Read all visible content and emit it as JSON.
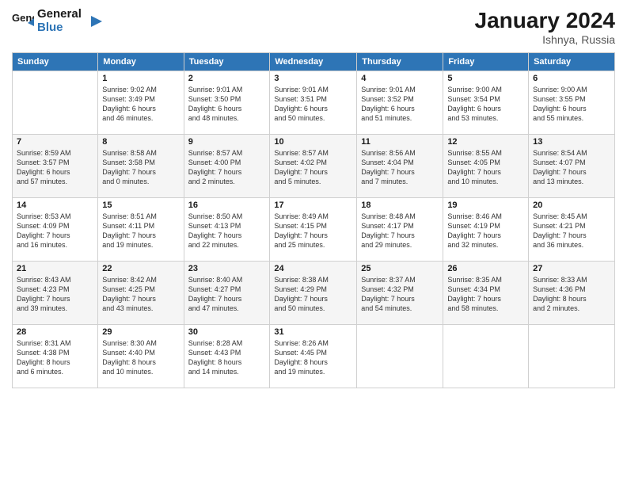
{
  "header": {
    "logo_line1": "General",
    "logo_line2": "Blue",
    "month_year": "January 2024",
    "location": "Ishnya, Russia"
  },
  "days_of_week": [
    "Sunday",
    "Monday",
    "Tuesday",
    "Wednesday",
    "Thursday",
    "Friday",
    "Saturday"
  ],
  "weeks": [
    [
      {
        "num": "",
        "info": ""
      },
      {
        "num": "1",
        "info": "Sunrise: 9:02 AM\nSunset: 3:49 PM\nDaylight: 6 hours\nand 46 minutes."
      },
      {
        "num": "2",
        "info": "Sunrise: 9:01 AM\nSunset: 3:50 PM\nDaylight: 6 hours\nand 48 minutes."
      },
      {
        "num": "3",
        "info": "Sunrise: 9:01 AM\nSunset: 3:51 PM\nDaylight: 6 hours\nand 50 minutes."
      },
      {
        "num": "4",
        "info": "Sunrise: 9:01 AM\nSunset: 3:52 PM\nDaylight: 6 hours\nand 51 minutes."
      },
      {
        "num": "5",
        "info": "Sunrise: 9:00 AM\nSunset: 3:54 PM\nDaylight: 6 hours\nand 53 minutes."
      },
      {
        "num": "6",
        "info": "Sunrise: 9:00 AM\nSunset: 3:55 PM\nDaylight: 6 hours\nand 55 minutes."
      }
    ],
    [
      {
        "num": "7",
        "info": "Sunrise: 8:59 AM\nSunset: 3:57 PM\nDaylight: 6 hours\nand 57 minutes."
      },
      {
        "num": "8",
        "info": "Sunrise: 8:58 AM\nSunset: 3:58 PM\nDaylight: 7 hours\nand 0 minutes."
      },
      {
        "num": "9",
        "info": "Sunrise: 8:57 AM\nSunset: 4:00 PM\nDaylight: 7 hours\nand 2 minutes."
      },
      {
        "num": "10",
        "info": "Sunrise: 8:57 AM\nSunset: 4:02 PM\nDaylight: 7 hours\nand 5 minutes."
      },
      {
        "num": "11",
        "info": "Sunrise: 8:56 AM\nSunset: 4:04 PM\nDaylight: 7 hours\nand 7 minutes."
      },
      {
        "num": "12",
        "info": "Sunrise: 8:55 AM\nSunset: 4:05 PM\nDaylight: 7 hours\nand 10 minutes."
      },
      {
        "num": "13",
        "info": "Sunrise: 8:54 AM\nSunset: 4:07 PM\nDaylight: 7 hours\nand 13 minutes."
      }
    ],
    [
      {
        "num": "14",
        "info": "Sunrise: 8:53 AM\nSunset: 4:09 PM\nDaylight: 7 hours\nand 16 minutes."
      },
      {
        "num": "15",
        "info": "Sunrise: 8:51 AM\nSunset: 4:11 PM\nDaylight: 7 hours\nand 19 minutes."
      },
      {
        "num": "16",
        "info": "Sunrise: 8:50 AM\nSunset: 4:13 PM\nDaylight: 7 hours\nand 22 minutes."
      },
      {
        "num": "17",
        "info": "Sunrise: 8:49 AM\nSunset: 4:15 PM\nDaylight: 7 hours\nand 25 minutes."
      },
      {
        "num": "18",
        "info": "Sunrise: 8:48 AM\nSunset: 4:17 PM\nDaylight: 7 hours\nand 29 minutes."
      },
      {
        "num": "19",
        "info": "Sunrise: 8:46 AM\nSunset: 4:19 PM\nDaylight: 7 hours\nand 32 minutes."
      },
      {
        "num": "20",
        "info": "Sunrise: 8:45 AM\nSunset: 4:21 PM\nDaylight: 7 hours\nand 36 minutes."
      }
    ],
    [
      {
        "num": "21",
        "info": "Sunrise: 8:43 AM\nSunset: 4:23 PM\nDaylight: 7 hours\nand 39 minutes."
      },
      {
        "num": "22",
        "info": "Sunrise: 8:42 AM\nSunset: 4:25 PM\nDaylight: 7 hours\nand 43 minutes."
      },
      {
        "num": "23",
        "info": "Sunrise: 8:40 AM\nSunset: 4:27 PM\nDaylight: 7 hours\nand 47 minutes."
      },
      {
        "num": "24",
        "info": "Sunrise: 8:38 AM\nSunset: 4:29 PM\nDaylight: 7 hours\nand 50 minutes."
      },
      {
        "num": "25",
        "info": "Sunrise: 8:37 AM\nSunset: 4:32 PM\nDaylight: 7 hours\nand 54 minutes."
      },
      {
        "num": "26",
        "info": "Sunrise: 8:35 AM\nSunset: 4:34 PM\nDaylight: 7 hours\nand 58 minutes."
      },
      {
        "num": "27",
        "info": "Sunrise: 8:33 AM\nSunset: 4:36 PM\nDaylight: 8 hours\nand 2 minutes."
      }
    ],
    [
      {
        "num": "28",
        "info": "Sunrise: 8:31 AM\nSunset: 4:38 PM\nDaylight: 8 hours\nand 6 minutes."
      },
      {
        "num": "29",
        "info": "Sunrise: 8:30 AM\nSunset: 4:40 PM\nDaylight: 8 hours\nand 10 minutes."
      },
      {
        "num": "30",
        "info": "Sunrise: 8:28 AM\nSunset: 4:43 PM\nDaylight: 8 hours\nand 14 minutes."
      },
      {
        "num": "31",
        "info": "Sunrise: 8:26 AM\nSunset: 4:45 PM\nDaylight: 8 hours\nand 19 minutes."
      },
      {
        "num": "",
        "info": ""
      },
      {
        "num": "",
        "info": ""
      },
      {
        "num": "",
        "info": ""
      }
    ]
  ]
}
